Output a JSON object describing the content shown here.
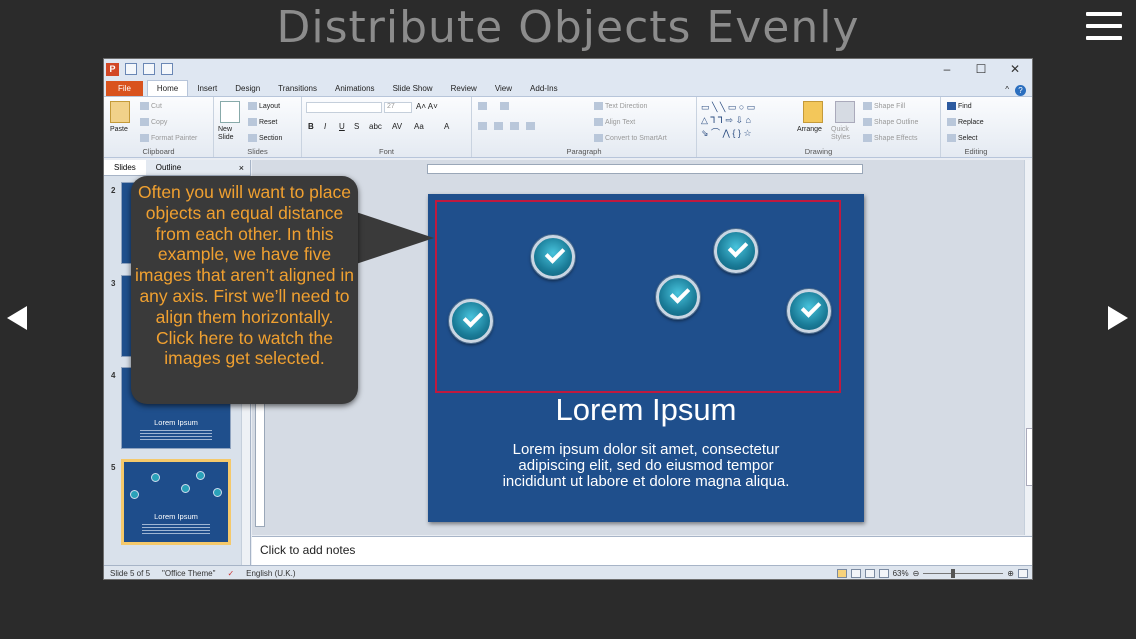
{
  "page": {
    "title": "Distribute Objects Evenly",
    "callout_text": "Often you will want to place objects an equal distance from each other. In this example, we have five images that aren’t aligned in any axis. First we’ll need to align them horizontally. Click here to watch the images get selected."
  },
  "ribbon": {
    "tabs": [
      "File",
      "Home",
      "Insert",
      "Design",
      "Transitions",
      "Animations",
      "Slide Show",
      "Review",
      "View",
      "Add-Ins"
    ],
    "active_tab": "Home",
    "clipboard": {
      "paste": "Paste",
      "cut": "Cut",
      "copy": "Copy",
      "format_painter": "Format Painter",
      "label": "Clipboard"
    },
    "slides": {
      "new_slide": "New Slide",
      "layout": "Layout",
      "reset": "Reset",
      "section": "Section",
      "label": "Slides"
    },
    "font": {
      "size": "27",
      "label": "Font"
    },
    "paragraph": {
      "text_direction": "Text Direction",
      "align_text": "Align Text",
      "convert_smartart": "Convert to SmartArt",
      "label": "Paragraph"
    },
    "drawing": {
      "arrange": "Arrange",
      "quick_styles": "Quick Styles",
      "shape_fill": "Shape Fill",
      "shape_outline": "Shape Outline",
      "shape_effects": "Shape Effects",
      "label": "Drawing"
    },
    "editing": {
      "find": "Find",
      "replace": "Replace",
      "select": "Select",
      "label": "Editing"
    }
  },
  "slides_panel": {
    "tab_slides": "Slides",
    "tab_outline": "Outline",
    "close": "×",
    "thumbs": [
      {
        "num": "2"
      },
      {
        "num": "3"
      },
      {
        "num": "4",
        "title": "Lorem Ipsum"
      },
      {
        "num": "5",
        "title": "Lorem Ipsum"
      }
    ]
  },
  "slide": {
    "title": "Lorem Ipsum",
    "body": "Lorem ipsum dolor sit amet, consectetur adipiscing elit, sed do eiusmod tempor incididunt ut labore et dolore magna aliqua."
  },
  "notes": {
    "placeholder": "Click to add notes"
  },
  "statusbar": {
    "slide": "Slide 5 of 5",
    "theme": "\"Office Theme\"",
    "language": "English (U.K.)",
    "zoom": "63%"
  },
  "window": {
    "minimize": "–",
    "maximize": "☐",
    "close": "✕"
  }
}
